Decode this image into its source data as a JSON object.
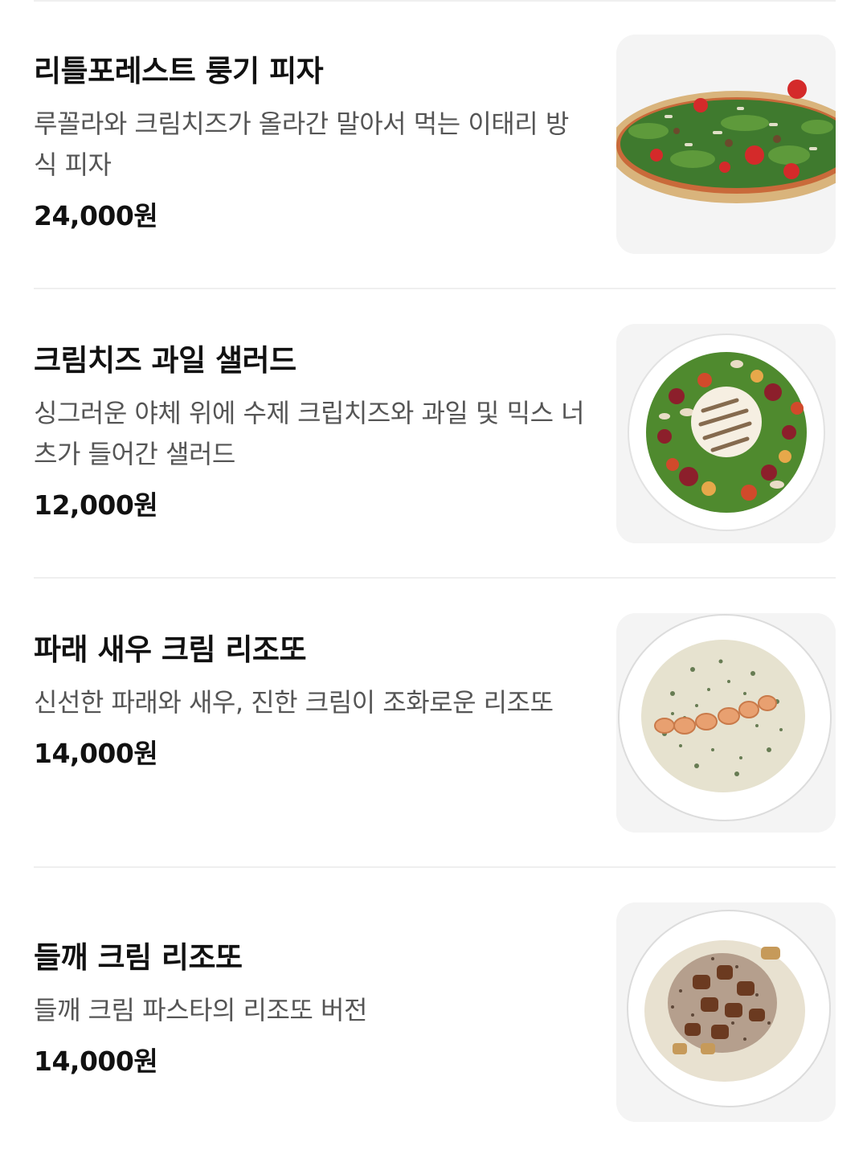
{
  "menu": {
    "items": [
      {
        "name": "리틀포레스트 룽기 피자",
        "description": "루꼴라와 크림치즈가 올라간 말아서 먹는 이태리 방식 피자",
        "price": "24,000원",
        "image_icon": "pizza-photo"
      },
      {
        "name": "크림치즈 과일 샐러드",
        "description": "싱그러운 야체 위에 수제 크립치즈와 과일 및 믹스 너츠가 들어간 샐러드",
        "price": "12,000원",
        "image_icon": "salad-photo"
      },
      {
        "name": "파래 새우 크림 리조또",
        "description": "신선한 파래와 새우, 진한 크림이 조화로운 리조또",
        "price": "14,000원",
        "image_icon": "shrimp-risotto-photo"
      },
      {
        "name": "들깨 크림 리조또",
        "description": "들깨 크림 파스타의 리조또 버전",
        "price": "14,000원",
        "image_icon": "perilla-risotto-photo"
      }
    ]
  },
  "colors": {
    "title": "#111111",
    "description": "#555555",
    "divider": "#efefef",
    "thumb_bg": "#f4f4f4"
  }
}
